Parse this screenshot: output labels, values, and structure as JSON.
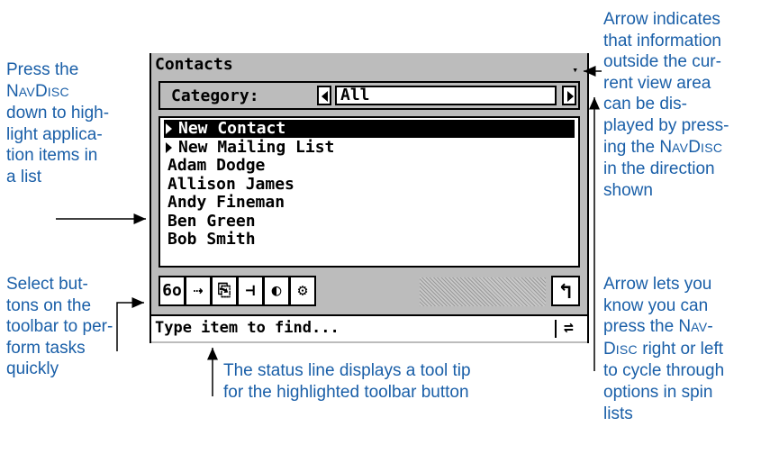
{
  "callouts": {
    "navdisc_down": {
      "line1": "Press the",
      "line2_pre": "N",
      "line2_sc": "AV",
      "line2_mid": "D",
      "line2_sc2": "ISC",
      "line3": "down to high-",
      "line4": "light applica-",
      "line5": "tion items in",
      "line6": "a list"
    },
    "toolbar": {
      "line1": "Select but-",
      "line2": "tons on the",
      "line3": "toolbar to per-",
      "line4": "form tasks",
      "line5": "quickly"
    },
    "status": {
      "line1": "The status line displays a tool tip",
      "line2": "for the highlighted toolbar button"
    },
    "scroll_arrow": {
      "line1": "Arrow indicates",
      "line2": "that information",
      "line3": "outside the cur-",
      "line4": "rent view area",
      "line5": "can be dis-",
      "line6": "played by press-",
      "line7_pre": "ing the N",
      "line7_sc": "AV",
      "line7_mid": "D",
      "line7_sc2": "ISC",
      "line8": "in the direction",
      "line9": "shown"
    },
    "spin_arrow": {
      "line1": "Arrow lets you",
      "line2": "know you can",
      "line3_pre": "press the N",
      "line3_sc": "AV",
      "line3_post": "-",
      "line4_pre": "D",
      "line4_sc": "ISC",
      "line4_post": " right or left",
      "line5": "to cycle through",
      "line6": "options in spin",
      "line7": "lists"
    }
  },
  "device": {
    "title": "Contacts",
    "scroll_indicator": "▾",
    "category_label": "Category:",
    "category_value": "All",
    "list_items": [
      {
        "label": "New Contact",
        "has_caret": true,
        "highlighted": true
      },
      {
        "label": "New Mailing List",
        "has_caret": true,
        "highlighted": false
      },
      {
        "label": "Adam Dodge",
        "has_caret": false,
        "highlighted": false
      },
      {
        "label": "Allison James",
        "has_caret": false,
        "highlighted": false
      },
      {
        "label": "Andy Fineman",
        "has_caret": false,
        "highlighted": false
      },
      {
        "label": "Ben Green",
        "has_caret": false,
        "highlighted": false
      },
      {
        "label": "Bob Smith",
        "has_caret": false,
        "highlighted": false
      }
    ],
    "toolbar_icons": [
      {
        "name": "glasses-icon",
        "glyph": "6o"
      },
      {
        "name": "send-icon",
        "glyph": "⇢"
      },
      {
        "name": "copy-document-icon",
        "glyph": "⎘"
      },
      {
        "name": "tree-icon",
        "glyph": "⊣"
      },
      {
        "name": "globe-icon",
        "glyph": "◐"
      },
      {
        "name": "settings-icon",
        "glyph": "⚙"
      }
    ],
    "back_glyph": "↰",
    "status_text": "Type item to find...",
    "status_icon_glyph": "⇌"
  },
  "colors": {
    "callout_text": "#1a5fa8",
    "device_gray": "#bcbcbc"
  }
}
